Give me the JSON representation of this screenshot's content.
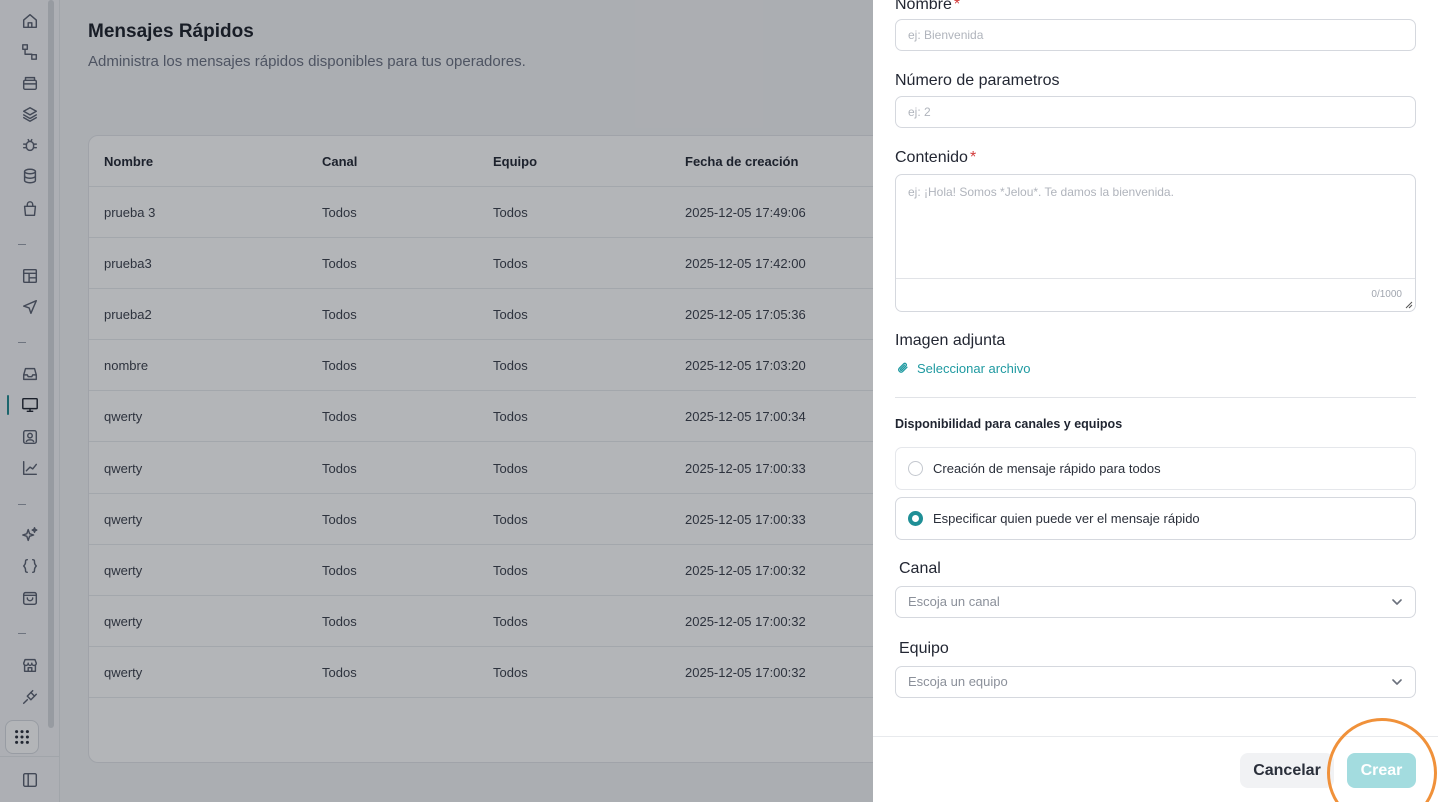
{
  "page": {
    "title": "Mensajes Rápidos",
    "subtitle": "Administra los mensajes rápidos disponibles para tus operadores."
  },
  "table": {
    "headers": [
      "Nombre",
      "Canal",
      "Equipo",
      "Fecha de creación"
    ],
    "rows": [
      [
        "prueba 3",
        "Todos",
        "Todos",
        "2025-12-05 17:49:06"
      ],
      [
        "prueba3",
        "Todos",
        "Todos",
        "2025-12-05 17:42:00"
      ],
      [
        "prueba2",
        "Todos",
        "Todos",
        "2025-12-05 17:05:36"
      ],
      [
        "nombre",
        "Todos",
        "Todos",
        "2025-12-05 17:03:20"
      ],
      [
        "qwerty",
        "Todos",
        "Todos",
        "2025-12-05 17:00:34"
      ],
      [
        "qwerty",
        "Todos",
        "Todos",
        "2025-12-05 17:00:33"
      ],
      [
        "qwerty",
        "Todos",
        "Todos",
        "2025-12-05 17:00:33"
      ],
      [
        "qwerty",
        "Todos",
        "Todos",
        "2025-12-05 17:00:32"
      ],
      [
        "qwerty",
        "Todos",
        "Todos",
        "2025-12-05 17:00:32"
      ],
      [
        "qwerty",
        "Todos",
        "Todos",
        "2025-12-05 17:00:32"
      ]
    ]
  },
  "sidebar": {
    "icons": [
      "home-icon",
      "flow-icon",
      "archive-icon",
      "layers-icon",
      "bug-icon",
      "database-icon",
      "bag-icon",
      "layout-icon",
      "send-icon",
      "inbox-icon",
      "monitor-icon",
      "contact-icon",
      "chart-icon",
      "sparkles-icon",
      "braces-icon",
      "shopping-bag-icon",
      "store-icon",
      "plug-icon",
      "apps-grid-icon",
      "sidebar-toggle-icon"
    ],
    "active": "monitor-icon"
  },
  "drawer": {
    "name_label": "Nombre",
    "name_required": "*",
    "name_placeholder": "ej: Bienvenida",
    "params_label": "Número de parametros",
    "params_placeholder": "ej: 2",
    "content_label": "Contenido",
    "content_required": "*",
    "content_placeholder": "ej: ¡Hola! Somos *Jelou*. Te damos la bienvenida.",
    "content_counter": "0/1000",
    "image_label": "Imagen adjunta",
    "file_link": "Seleccionar archivo",
    "availability_title": "Disponibilidad para canales y equipos",
    "radio_all": "Creación de mensaje rápido para todos",
    "radio_specific": "Especificar quien puede ver el mensaje rápido",
    "selected_option": "specific",
    "channel_label": "Canal",
    "channel_placeholder": "Escoja un canal",
    "team_label": "Equipo",
    "team_placeholder": "Escoja un equipo",
    "cancel_label": "Cancelar",
    "create_label": "Crear"
  },
  "colors": {
    "accent": "#1f8f96",
    "create_disabled": "#a3dcdf",
    "highlight_ring": "#f0913a",
    "required": "#d23a3a"
  }
}
